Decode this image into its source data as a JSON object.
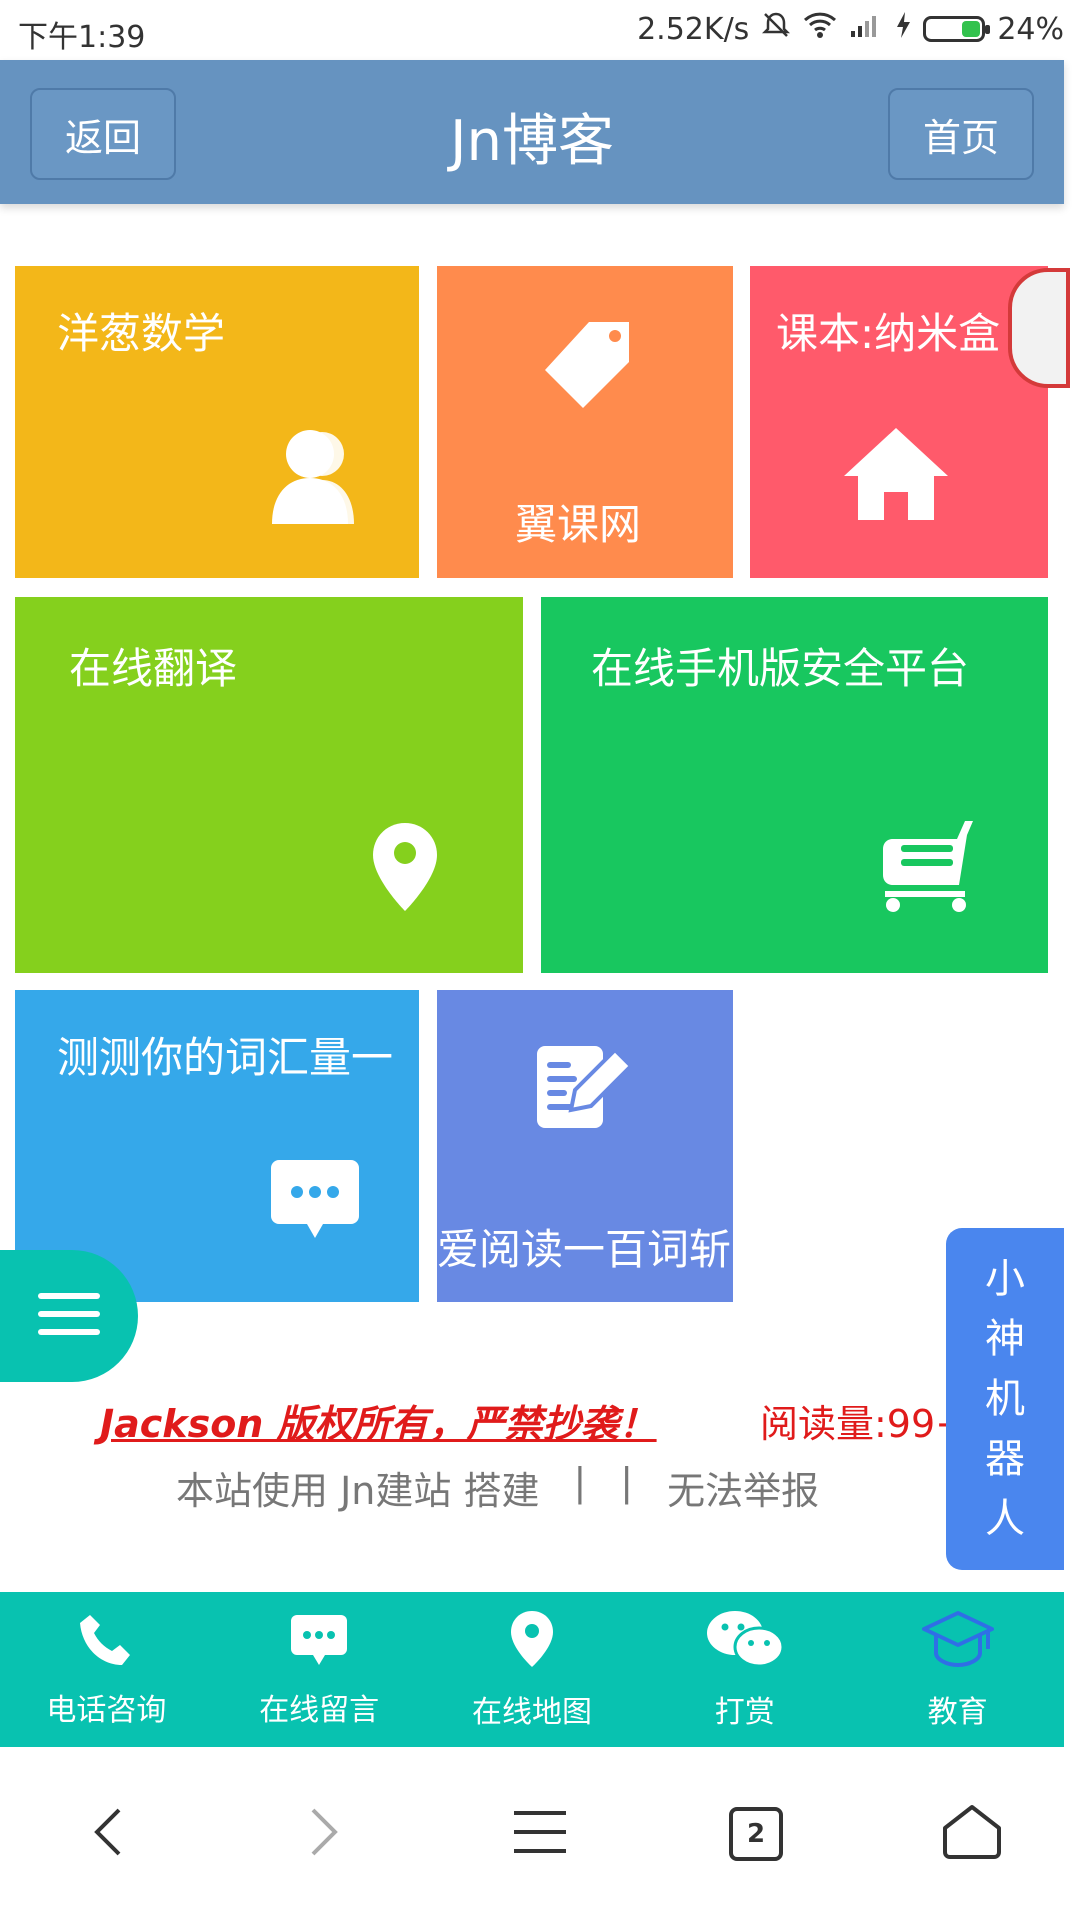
{
  "status_bar": {
    "time": "下午1:39",
    "network_speed": "2.52K/s",
    "battery": "24%"
  },
  "header": {
    "back_label": "返回",
    "title": "Jn博客",
    "home_label": "首页"
  },
  "tiles": [
    {
      "label": "洋葱数学",
      "color": "#f3b719",
      "icon": "user-icon"
    },
    {
      "label": "翼课网",
      "color": "#ff8b4d",
      "icon": "tag-icon"
    },
    {
      "label": "课本:纳米盒",
      "color": "#ff5a6b",
      "icon": "home-icon"
    },
    {
      "label": "在线翻译",
      "color": "#85d01d",
      "icon": "location-pin-icon"
    },
    {
      "label": "在线手机版安全平台",
      "color": "#18c75f",
      "icon": "shopping-cart-icon"
    },
    {
      "label": "测测你的词汇量一",
      "color": "#35a8ea",
      "icon": "chat-bubble-icon"
    },
    {
      "label": "爱阅读一百词斩",
      "color": "#6889e3",
      "icon": "edit-document-icon"
    }
  ],
  "floating": {
    "robot_label": "小神机器人",
    "robot_chars": [
      "小",
      "神",
      "机",
      "器",
      "人"
    ]
  },
  "footer": {
    "copyright": "Jackson 版权所有，严禁抄袭！",
    "reads": "阅读量:99+",
    "built_with": "本站使用 Jn建站 搭建",
    "sep1": "|",
    "sep2": "|",
    "report": "无法举报"
  },
  "bottom_nav": [
    {
      "label": "电话咨询",
      "icon": "phone-icon"
    },
    {
      "label": "在线留言",
      "icon": "message-icon"
    },
    {
      "label": "在线地图",
      "icon": "map-pin-icon"
    },
    {
      "label": "打赏",
      "icon": "wechat-icon"
    },
    {
      "label": "教育",
      "icon": "graduation-cap-icon"
    }
  ],
  "system_nav": {
    "tabs_count": "2"
  },
  "colors": {
    "header": "#6693c0",
    "bottom_nav": "#08c2b0",
    "robot": "#4a86ee",
    "copyright_red": "#e01b1b"
  }
}
